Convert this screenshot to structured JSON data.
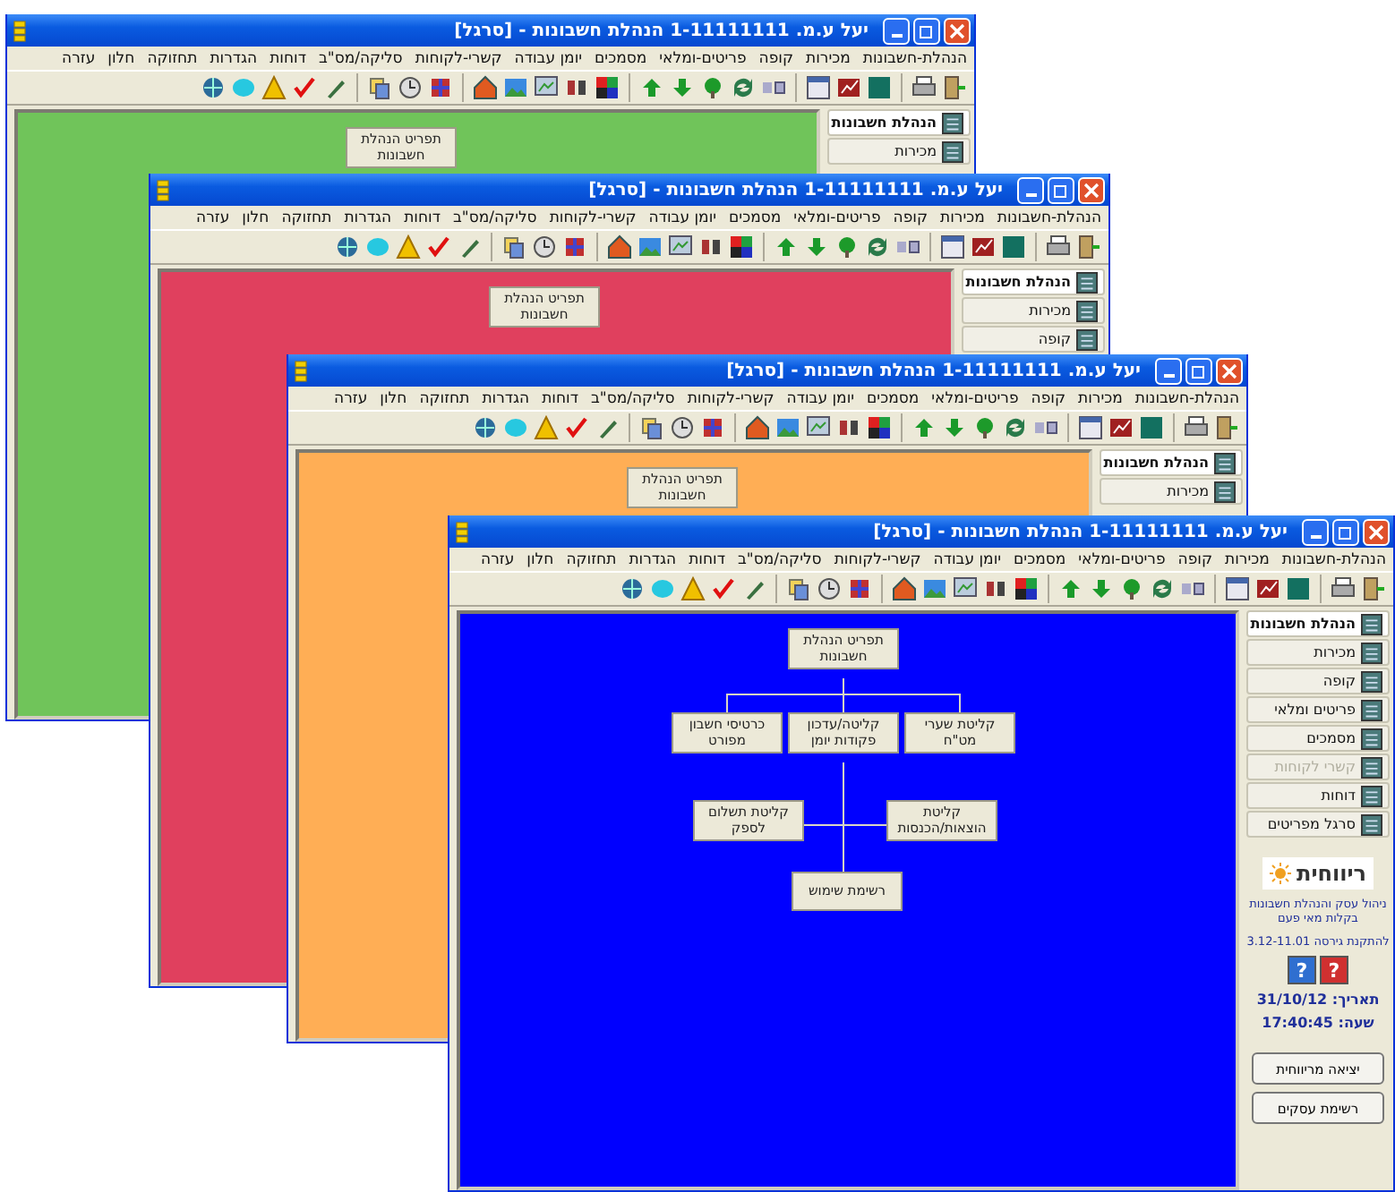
{
  "windows": [
    {
      "title": "יעל ע.מ. 1-11111111 הנהלת חשבונות - [סרגל]",
      "color": "#70c45a",
      "menu": [
        "הנהלת-חשבונות",
        "מכירות",
        "קופה",
        "פריטים-ומלאי",
        "מסמכים",
        "יומן עבודה",
        "קשרי-לקוחות",
        "סליקה/מס\"ב",
        "דוחות",
        "הגדרות",
        "תחזוקה",
        "חלון",
        "עזרה"
      ],
      "sidebar": [
        {
          "label": "הנהלת חשבונות",
          "selected": true,
          "disabled": false
        },
        {
          "label": "מכירות",
          "selected": false,
          "disabled": false
        }
      ],
      "diagram": [
        {
          "text": "תפריט הנהלת חשבונות"
        }
      ]
    },
    {
      "title": "יעל ע.מ. 1-11111111 הנהלת חשבונות - [סרגל]",
      "color": "#e0405e",
      "menu": [
        "הנהלת-חשבונות",
        "מכירות",
        "קופה",
        "פריטים-ומלאי",
        "מסמכים",
        "יומן עבודה",
        "קשרי-לקוחות",
        "סליקה/מס\"ב",
        "דוחות",
        "הגדרות",
        "תחזוקה",
        "חלון",
        "עזרה"
      ],
      "sidebar": [
        {
          "label": "הנהלת חשבונות",
          "selected": true,
          "disabled": false
        },
        {
          "label": "מכירות",
          "selected": false,
          "disabled": false
        },
        {
          "label": "קופה",
          "selected": false,
          "disabled": false
        }
      ],
      "diagram": [
        {
          "text": "תפריט הנהלת חשבונות"
        }
      ]
    },
    {
      "title": "יעל ע.מ. 1-11111111 הנהלת חשבונות - [סרגל]",
      "color": "#ffae55",
      "menu": [
        "הנהלת-חשבונות",
        "מכירות",
        "קופה",
        "פריטים-ומלאי",
        "מסמכים",
        "יומן עבודה",
        "קשרי-לקוחות",
        "סליקה/מס\"ב",
        "דוחות",
        "הגדרות",
        "תחזוקה",
        "חלון",
        "עזרה"
      ],
      "sidebar": [
        {
          "label": "הנהלת חשבונות",
          "selected": true,
          "disabled": false
        },
        {
          "label": "מכירות",
          "selected": false,
          "disabled": false
        }
      ],
      "diagram": [
        {
          "text": "תפריט הנהלת חשבונות"
        }
      ]
    },
    {
      "title": "יעל ע.מ. 1-11111111 הנהלת חשבונות - [סרגל]",
      "color": "#0000ff",
      "menu": [
        "הנהלת-חשבונות",
        "מכירות",
        "קופה",
        "פריטים-ומלאי",
        "מסמכים",
        "יומן עבודה",
        "קשרי-לקוחות",
        "סליקה/מס\"ב",
        "דוחות",
        "הגדרות",
        "תחזוקה",
        "חלון",
        "עזרה"
      ],
      "sidebar": [
        {
          "label": "הנהלת חשבונות",
          "selected": true,
          "disabled": false
        },
        {
          "label": "מכירות",
          "selected": false,
          "disabled": false
        },
        {
          "label": "קופה",
          "selected": false,
          "disabled": false
        },
        {
          "label": "פריטים ומלאי",
          "selected": false,
          "disabled": false
        },
        {
          "label": "מסמכים",
          "selected": false,
          "disabled": false
        },
        {
          "label": "קשרי לקוחות",
          "selected": false,
          "disabled": true
        },
        {
          "label": "דוחות",
          "selected": false,
          "disabled": false
        },
        {
          "label": "סרגל מפריטים",
          "selected": false,
          "disabled": false
        }
      ],
      "diagram": [
        {
          "text": "תפריט הנהלת חשבונות"
        },
        {
          "text": "קליטת שערי מט\"ח"
        },
        {
          "text": "קליטה/עדכון פקודות יומן"
        },
        {
          "text": "כרטיסי חשבון מפורט"
        },
        {
          "text": "קליטת הוצאות/הכנסות"
        },
        {
          "text": "קליטת תשלום לספק"
        },
        {
          "text": "רשימת שימוש"
        }
      ],
      "info": {
        "logo": "ריווחית",
        "tagline": "ניהול עסק והנהלת חשבונות בקלות מאי פעם",
        "version": "להתקנת גירסה 3.12-11.01",
        "help_buttons": [
          {
            "label": "?",
            "color": "#d03030"
          },
          {
            "label": "?",
            "color": "#2f6fd0"
          }
        ],
        "date": "תאריך: 31/10/12",
        "time": "שעה: 17:40:45",
        "buttons": [
          "יציאה מריווחית",
          "רשימת עסקים"
        ]
      }
    }
  ]
}
